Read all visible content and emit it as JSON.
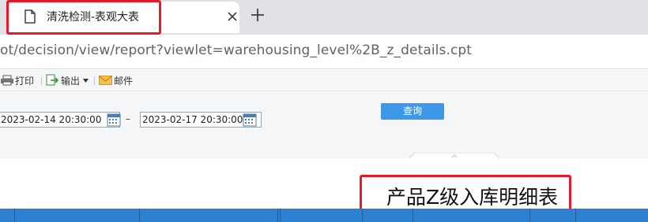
{
  "browser": {
    "tab_title": "清洗检测-表观大表",
    "url": "ot/decision/view/report?viewlet=warehousing_level%2B_z_details.cpt"
  },
  "toolbar": {
    "print_label": "打印",
    "export_label": "输出",
    "mail_label": "邮件"
  },
  "params": {
    "start_date": "2023-02-14 20:30:00",
    "range_separator": "–",
    "end_date": "2023-02-17 20:30:00",
    "query_label": "查询"
  },
  "report": {
    "title": "产品Z级入库明细表",
    "columns": [
      "",
      "",
      "",
      "",
      "",
      "",
      "",
      "",
      ""
    ]
  },
  "colors": {
    "highlight": "#e8192c",
    "header_blue": "#2e80d0",
    "query_blue": "#3d98ea"
  }
}
